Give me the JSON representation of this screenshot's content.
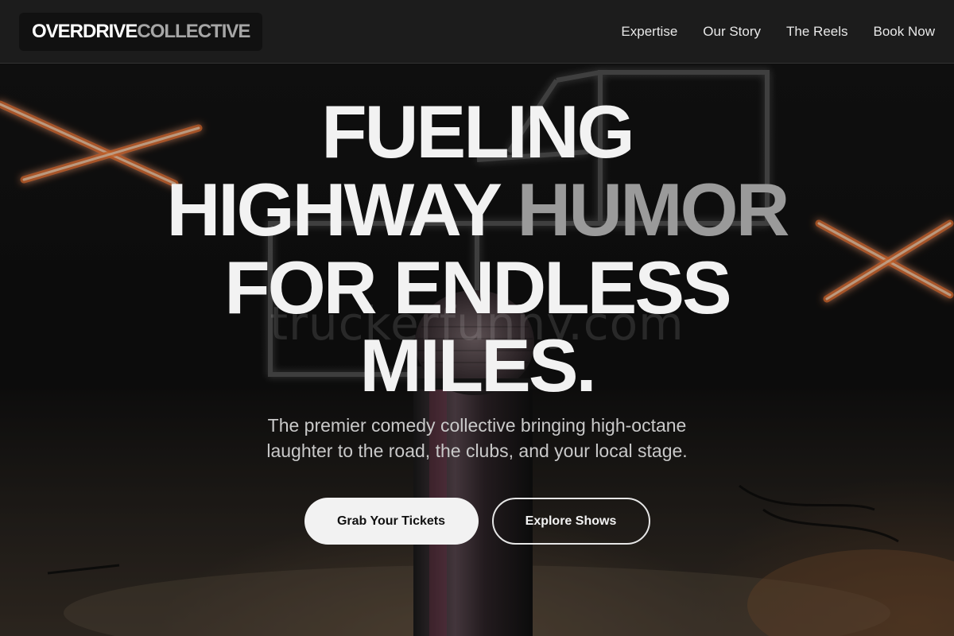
{
  "nav": {
    "logo": {
      "primary": "OVERDRIVE",
      "secondary": "COLLECTIVE"
    },
    "links": [
      "Expertise",
      "Our Story",
      "The Reels",
      "Book Now"
    ]
  },
  "hero": {
    "headline": {
      "line1": "FUELING",
      "line2_a": "HIGHWAY",
      "line2_b": "HUMOR",
      "line3": "FOR ENDLESS",
      "line4": "MILES."
    },
    "subtitle": {
      "line1": "The premier comedy collective bringing high-octane",
      "line2": "laughter to the road, the clubs, and your local stage."
    },
    "cta_primary": "Grab Your Tickets",
    "cta_secondary": "Explore Shows",
    "watermark": "truckerfunny.com",
    "background_image": "microphone-stage-neon"
  },
  "colors": {
    "nav_bg": "#1c1c1c",
    "text_primary": "#f2f2f2",
    "text_accent": "#9a9a9a",
    "neon_orange": "#ff7a2e"
  }
}
